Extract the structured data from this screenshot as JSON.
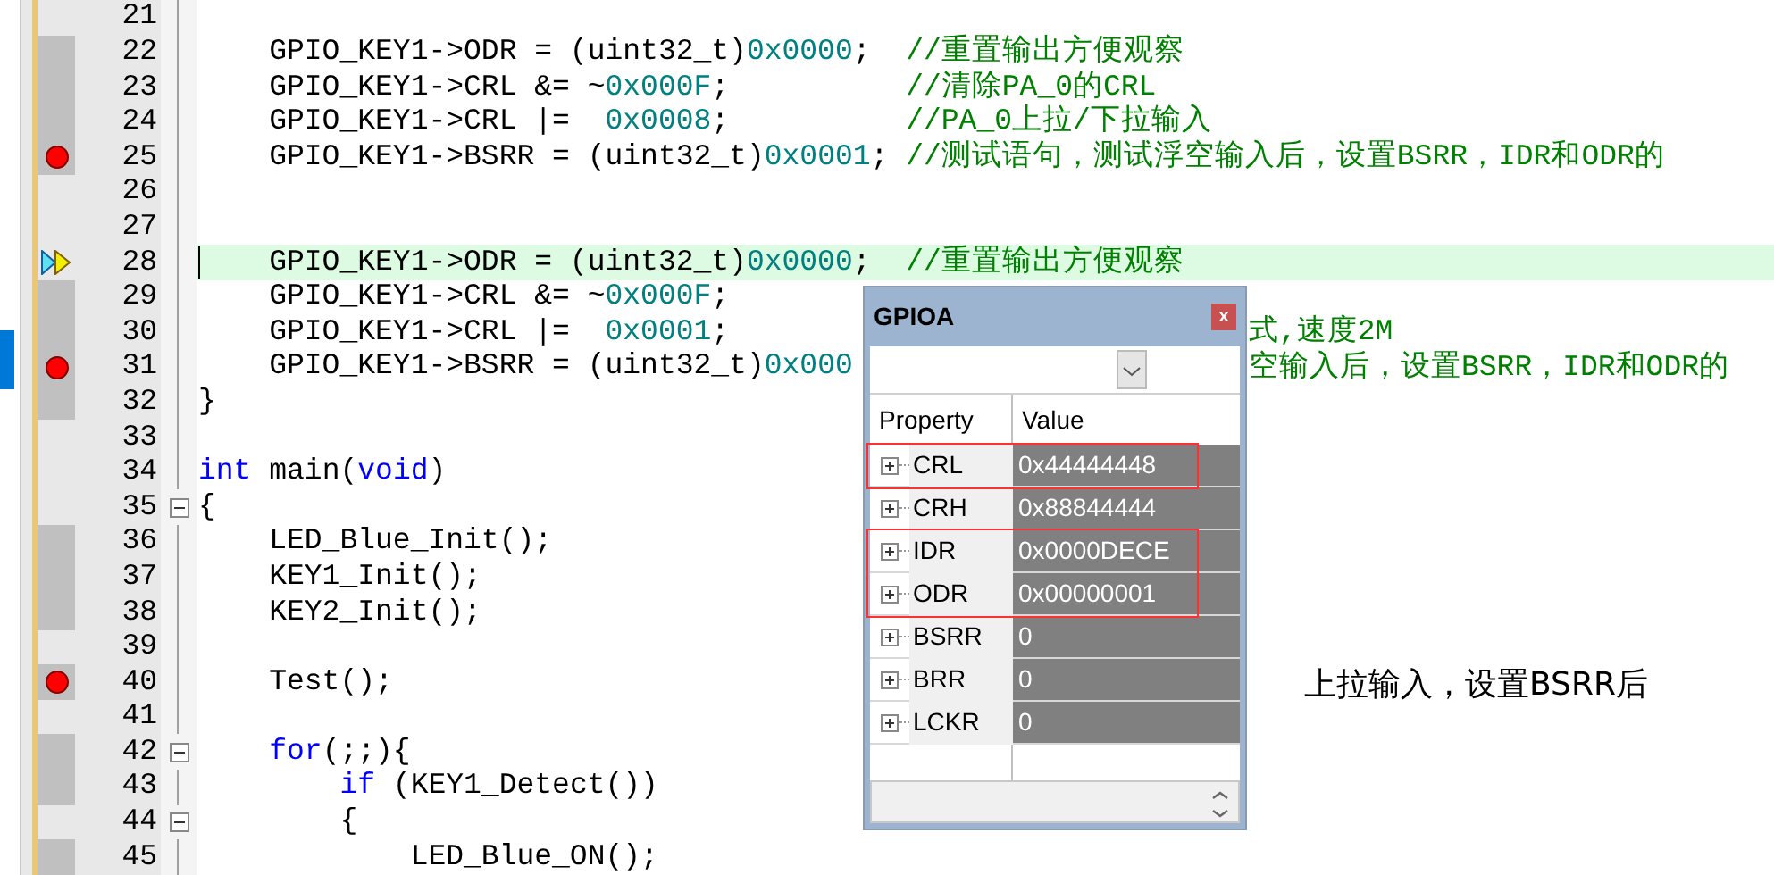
{
  "editor": {
    "lines": [
      {
        "number": "21",
        "executable": false,
        "breakpoint": false,
        "current": false,
        "fold": false
      },
      {
        "number": "22",
        "executable": true,
        "breakpoint": false,
        "current": false,
        "fold": false,
        "segments": [
          {
            "kind": "plain",
            "text": "    GPIO_KEY1->ODR = (uint32_t)"
          },
          {
            "kind": "number",
            "text": "0x0000"
          },
          {
            "kind": "plain",
            "text": ";  "
          },
          {
            "kind": "comment",
            "text": "//重置输出方便观察"
          }
        ]
      },
      {
        "number": "23",
        "executable": true,
        "breakpoint": false,
        "current": false,
        "fold": false,
        "segments": [
          {
            "kind": "plain",
            "text": "    GPIO_KEY1->CRL &= ~"
          },
          {
            "kind": "number",
            "text": "0x000F"
          },
          {
            "kind": "plain",
            "text": ";          "
          },
          {
            "kind": "comment",
            "text": "//清除PA_0的CRL"
          }
        ]
      },
      {
        "number": "24",
        "executable": true,
        "breakpoint": false,
        "current": false,
        "fold": false,
        "segments": [
          {
            "kind": "plain",
            "text": "    GPIO_KEY1->CRL |=  "
          },
          {
            "kind": "number",
            "text": "0x0008"
          },
          {
            "kind": "plain",
            "text": ";          "
          },
          {
            "kind": "comment",
            "text": "//PA_0上拉/下拉输入"
          }
        ]
      },
      {
        "number": "25",
        "executable": true,
        "breakpoint": true,
        "current": false,
        "fold": false,
        "segments": [
          {
            "kind": "plain",
            "text": "    GPIO_KEY1->BSRR = (uint32_t)"
          },
          {
            "kind": "number",
            "text": "0x0001"
          },
          {
            "kind": "plain",
            "text": "; "
          },
          {
            "kind": "comment",
            "text": "//测试语句，测试浮空输入后，设置BSRR，IDR和ODR的"
          }
        ]
      },
      {
        "number": "26",
        "executable": false,
        "breakpoint": false,
        "current": false,
        "fold": false
      },
      {
        "number": "27",
        "executable": false,
        "breakpoint": false,
        "current": false,
        "fold": false
      },
      {
        "number": "28",
        "executable": false,
        "breakpoint": false,
        "current": true,
        "fold": false,
        "segments": [
          {
            "kind": "plain",
            "text": "    GPIO_KEY1->ODR = (uint32_t)"
          },
          {
            "kind": "number",
            "text": "0x0000"
          },
          {
            "kind": "plain",
            "text": ";  "
          },
          {
            "kind": "comment",
            "text": "//重置输出方便观察"
          }
        ]
      },
      {
        "number": "29",
        "executable": true,
        "breakpoint": false,
        "current": false,
        "fold": false,
        "segments": [
          {
            "kind": "plain",
            "text": "    GPIO_KEY1->CRL &= ~"
          },
          {
            "kind": "number",
            "text": "0x000F"
          },
          {
            "kind": "plain",
            "text": ";"
          }
        ]
      },
      {
        "number": "30",
        "executable": true,
        "breakpoint": false,
        "current": false,
        "fold": false,
        "segments": [
          {
            "kind": "plain",
            "text": "    GPIO_KEY1->CRL |=  "
          },
          {
            "kind": "number",
            "text": "0x0001"
          },
          {
            "kind": "plain",
            "text": ";"
          }
        ],
        "tail": "式,速度2M"
      },
      {
        "number": "31",
        "executable": true,
        "breakpoint": true,
        "current": false,
        "fold": false,
        "segments": [
          {
            "kind": "plain",
            "text": "    GPIO_KEY1->BSRR = (uint32_t)"
          },
          {
            "kind": "number",
            "text": "0x000"
          }
        ],
        "tail": "空输入后，设置BSRR，IDR和ODR的"
      },
      {
        "number": "32",
        "executable": true,
        "breakpoint": false,
        "current": false,
        "fold": false,
        "segments": [
          {
            "kind": "plain",
            "text": "}"
          }
        ]
      },
      {
        "number": "33",
        "executable": false,
        "breakpoint": false,
        "current": false,
        "fold": false
      },
      {
        "number": "34",
        "executable": false,
        "breakpoint": false,
        "current": false,
        "fold": false,
        "segments": [
          {
            "kind": "keyword",
            "text": "int"
          },
          {
            "kind": "plain",
            "text": " main("
          },
          {
            "kind": "keyword",
            "text": "void"
          },
          {
            "kind": "plain",
            "text": ")"
          }
        ]
      },
      {
        "number": "35",
        "executable": false,
        "breakpoint": false,
        "current": false,
        "fold": true,
        "segments": [
          {
            "kind": "plain",
            "text": "{"
          }
        ]
      },
      {
        "number": "36",
        "executable": true,
        "breakpoint": false,
        "current": false,
        "fold": false,
        "segments": [
          {
            "kind": "plain",
            "text": "    LED_Blue_Init();"
          }
        ]
      },
      {
        "number": "37",
        "executable": true,
        "breakpoint": false,
        "current": false,
        "fold": false,
        "segments": [
          {
            "kind": "plain",
            "text": "    KEY1_Init();"
          }
        ]
      },
      {
        "number": "38",
        "executable": true,
        "breakpoint": false,
        "current": false,
        "fold": false,
        "segments": [
          {
            "kind": "plain",
            "text": "    KEY2_Init();"
          }
        ]
      },
      {
        "number": "39",
        "executable": false,
        "breakpoint": false,
        "current": false,
        "fold": false
      },
      {
        "number": "40",
        "executable": true,
        "breakpoint": true,
        "current": false,
        "fold": false,
        "segments": [
          {
            "kind": "plain",
            "text": "    Test();"
          }
        ]
      },
      {
        "number": "41",
        "executable": false,
        "breakpoint": false,
        "current": false,
        "fold": false
      },
      {
        "number": "42",
        "executable": true,
        "breakpoint": false,
        "current": false,
        "fold": true,
        "segments": [
          {
            "kind": "keyword",
            "text": "    for"
          },
          {
            "kind": "plain",
            "text": "(;;){"
          }
        ]
      },
      {
        "number": "43",
        "executable": true,
        "breakpoint": false,
        "current": false,
        "fold": false,
        "segments": [
          {
            "kind": "keyword",
            "text": "        if"
          },
          {
            "kind": "plain",
            "text": " (KEY1_Detect())"
          }
        ]
      },
      {
        "number": "44",
        "executable": false,
        "breakpoint": false,
        "current": false,
        "fold": true,
        "segments": [
          {
            "kind": "plain",
            "text": "        {"
          }
        ]
      },
      {
        "number": "45",
        "executable": true,
        "breakpoint": false,
        "current": false,
        "fold": false,
        "segments": [
          {
            "kind": "plain",
            "text": "            LED_Blue_ON();"
          }
        ]
      }
    ]
  },
  "peripheral_window": {
    "title": "GPIOA",
    "close": "x",
    "columns": [
      "Property",
      "Value"
    ],
    "rows": [
      {
        "name": "CRL",
        "value": "0x44444448",
        "boxed": true
      },
      {
        "name": "CRH",
        "value": "0x88844444",
        "boxed": false
      },
      {
        "name": "IDR",
        "value": "0x0000DECE",
        "boxed": true
      },
      {
        "name": "ODR",
        "value": "0x00000001",
        "boxed": true
      },
      {
        "name": "BSRR",
        "value": "0",
        "boxed": false
      },
      {
        "name": "BRR",
        "value": "0",
        "boxed": false
      },
      {
        "name": "LCKR",
        "value": "0",
        "boxed": false
      }
    ]
  },
  "annotation": "上拉输入，设置BSRR后"
}
